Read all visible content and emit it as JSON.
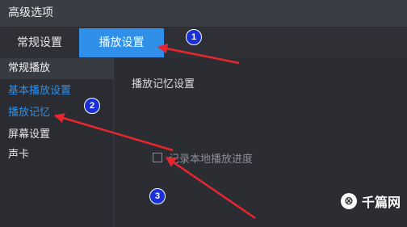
{
  "window": {
    "title": "高级选项"
  },
  "tabs": [
    {
      "label": "常规设置"
    },
    {
      "label": "播放设置"
    }
  ],
  "sidebar": {
    "header": "常规播放",
    "items": [
      {
        "label": "基本播放设置"
      },
      {
        "label": "播放记忆"
      },
      {
        "label": "屏幕设置"
      },
      {
        "label": "声卡"
      }
    ]
  },
  "content": {
    "section_title": "播放记忆设置",
    "checkbox_label": "记录本地播放进度",
    "checkbox_checked": false
  },
  "annotations": [
    {
      "number": "1"
    },
    {
      "number": "2"
    },
    {
      "number": "3"
    }
  ],
  "colors": {
    "accent": "#2f8fe9",
    "arrow": "#e8262e",
    "badge": "#1a2fd6"
  },
  "watermark": {
    "logo_icon": "logo-icon",
    "text": "千篇网"
  }
}
